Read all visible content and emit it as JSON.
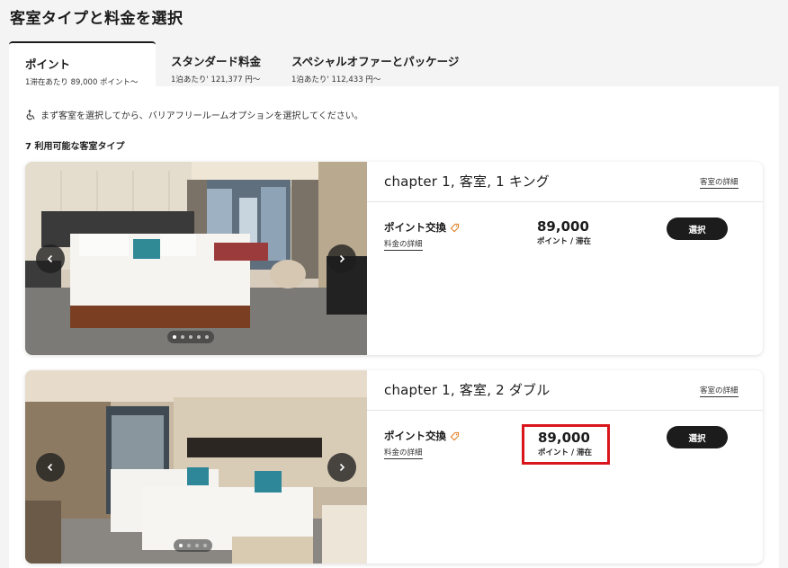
{
  "page_title": "客室タイプと料金を選択",
  "tabs": [
    {
      "label": "ポイント",
      "sub": "1滞在あたり 89,000 ポイント～"
    },
    {
      "label": "スタンダード料金",
      "sub": "1泊あたり' 121,377 円～"
    },
    {
      "label": "スペシャルオファーとパッケージ",
      "sub": "1泊あたり' 112,433 円～"
    }
  ],
  "accessibility_note": "まず客室を選択してから、バリアフリールームオプションを選択してください。",
  "available_count_label": "7 利用可能な客室タイプ",
  "rooms": [
    {
      "name": "chapter 1, 客室, 1 キング",
      "details_link": "客室の詳細",
      "rate_name": "ポイント交換",
      "rate_details_link": "料金の詳細",
      "price": "89,000",
      "price_unit": "ポイント / 滞在",
      "select_label": "選択",
      "image_count": 5,
      "image_active": 1
    },
    {
      "name": "chapter 1, 客室, 2 ダブル",
      "details_link": "客室の詳細",
      "rate_name": "ポイント交換",
      "rate_details_link": "料金の詳細",
      "price": "89,000",
      "price_unit": "ポイント / 滞在",
      "select_label": "選択",
      "image_count": 4,
      "image_active": 1
    }
  ],
  "colors": {
    "accent": "#1c1c1c",
    "highlight_border": "#d9161c",
    "tag_icon": "#e07a1f"
  }
}
